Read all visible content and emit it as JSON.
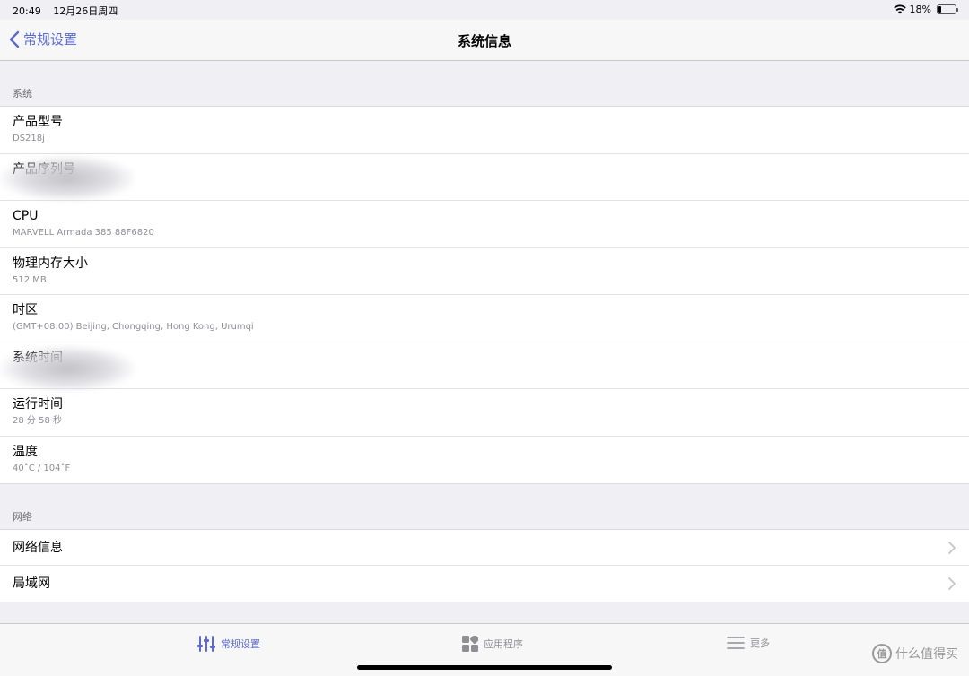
{
  "status": {
    "time": "20:49",
    "date": "12月26日周四",
    "battery_percent": "18%",
    "battery_level": 0.18
  },
  "nav": {
    "back_label": "常规设置",
    "title": "系统信息"
  },
  "system_section": {
    "header": "系统",
    "rows": [
      {
        "title": "产品型号",
        "value": "DS218j"
      },
      {
        "title": "产品序列号",
        "value": ""
      },
      {
        "title": "CPU",
        "value": "MARVELL Armada 385 88F6820"
      },
      {
        "title": "物理内存大小",
        "value": "512 MB"
      },
      {
        "title": "时区",
        "value": "(GMT+08:00) Beijing, Chongqing, Hong Kong, Urumqi"
      },
      {
        "title": "系统时间",
        "value": ""
      },
      {
        "title": "运行时间",
        "value": "28 分 58 秒"
      },
      {
        "title": "温度",
        "value": "40˚C / 104˚F"
      }
    ]
  },
  "network_section": {
    "header": "网络",
    "rows": [
      {
        "title": "网络信息"
      },
      {
        "title": "局域网"
      }
    ]
  },
  "tabs": [
    {
      "label": "常规设置",
      "icon": "sliders-icon",
      "active": true
    },
    {
      "label": "应用程序",
      "icon": "apps-grid-icon",
      "active": false
    },
    {
      "label": "更多",
      "icon": "menu-lines-icon",
      "active": false
    }
  ],
  "watermark": {
    "logo_text": "值",
    "text": "什么值得买"
  },
  "colors": {
    "accent": "#5b6ad0",
    "background": "#efeff4"
  }
}
